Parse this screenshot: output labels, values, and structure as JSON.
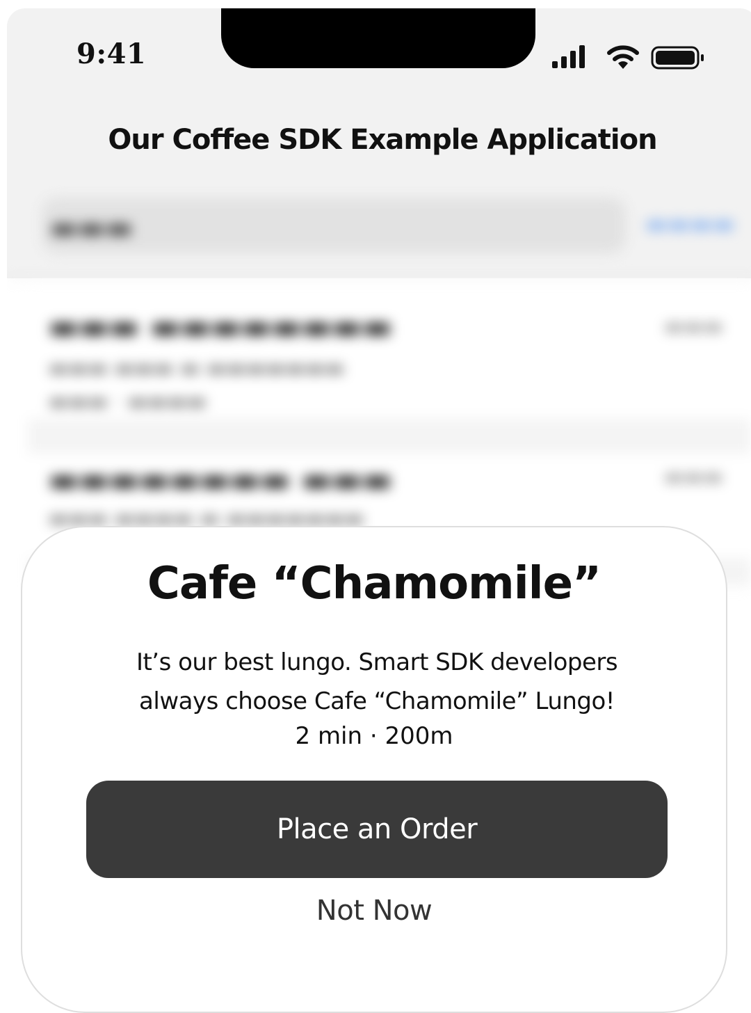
{
  "status_bar": {
    "time": "9:41",
    "icons": [
      "signal-icon",
      "wifi-icon",
      "battery-icon"
    ]
  },
  "app": {
    "title": "Our Coffee SDK Example Application"
  },
  "sheet": {
    "title": "Cafe “Chamomile”",
    "description_line1": "It’s our best lungo. Smart SDK developers",
    "description_line2": "always choose Cafe “Chamomile” Lungo!",
    "meta": "2 min · 200m",
    "primary_button": "Place an Order",
    "secondary_button": "Not Now"
  },
  "colors": {
    "button_bg": "#3a3a3a",
    "background": "#f2f2f2",
    "accent_blurred": "#8ab4f0"
  }
}
